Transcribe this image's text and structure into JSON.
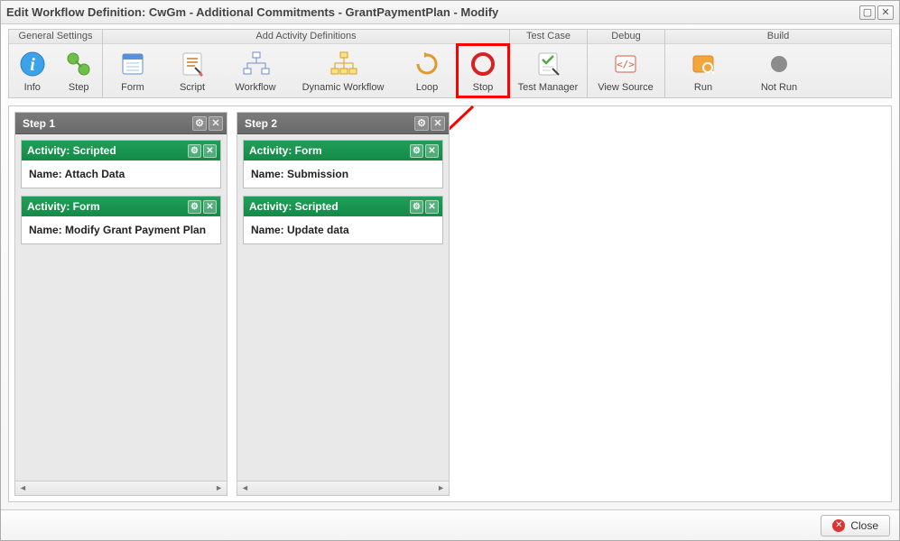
{
  "window": {
    "title": "Edit Workflow Definition: CwGm - Additional Commitments - GrantPaymentPlan - Modify"
  },
  "ribbon": {
    "groups": {
      "general": {
        "header": "General Settings",
        "info": "Info",
        "step": "Step"
      },
      "add": {
        "header": "Add Activity Definitions",
        "form": "Form",
        "script": "Script",
        "workflow": "Workflow",
        "dynamic": "Dynamic Workflow",
        "loop": "Loop",
        "stop": "Stop"
      },
      "testcase": {
        "header": "Test Case",
        "testManager": "Test Manager"
      },
      "debug": {
        "header": "Debug",
        "viewSource": "View Source"
      },
      "build": {
        "header": "Build",
        "run": "Run",
        "notRun": "Not Run"
      }
    }
  },
  "steps": [
    {
      "title": "Step 1",
      "activities": [
        {
          "header": "Activity: Scripted",
          "name": "Name: Attach Data"
        },
        {
          "header": "Activity: Form",
          "name": "Name: Modify Grant Payment Plan"
        }
      ]
    },
    {
      "title": "Step 2",
      "activities": [
        {
          "header": "Activity: Form",
          "name": "Name: Submission"
        },
        {
          "header": "Activity: Scripted",
          "name": "Name: Update data"
        }
      ]
    }
  ],
  "footer": {
    "close": "Close"
  }
}
